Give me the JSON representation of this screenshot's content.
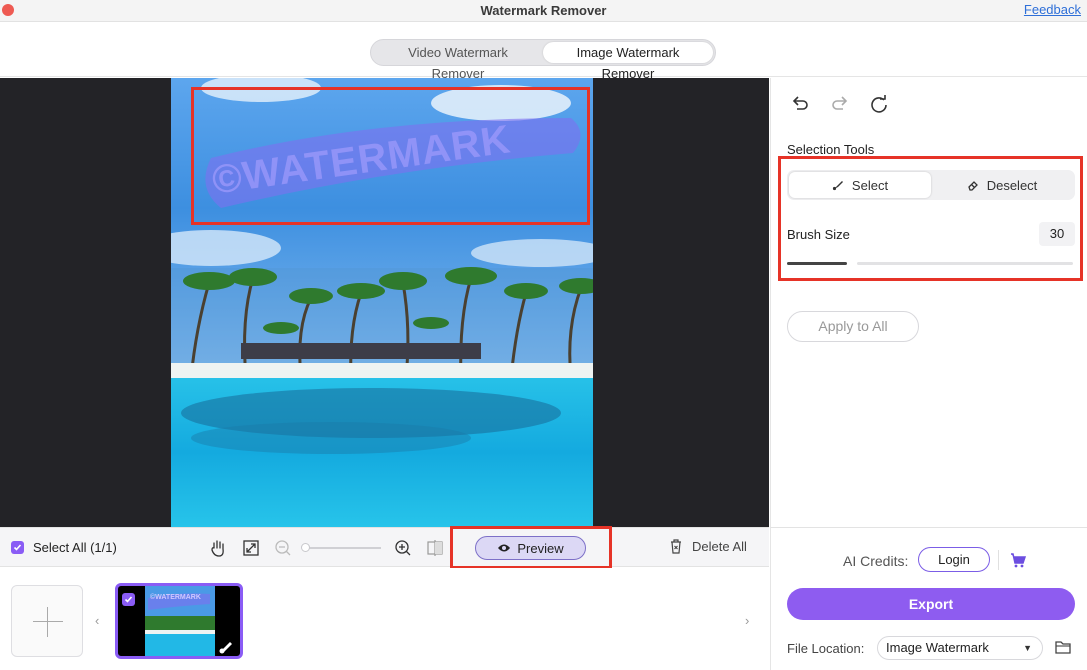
{
  "app": {
    "title": "Watermark Remover",
    "feedback_link": "Feedback"
  },
  "tabs": [
    {
      "label": "Video Watermark Remover",
      "active": false
    },
    {
      "label": "Image Watermark Remover",
      "active": true
    }
  ],
  "canvas": {
    "watermark_text": "©WATERMARK"
  },
  "right_panel": {
    "selection_tools_label": "Selection Tools",
    "select_label": "Select",
    "deselect_label": "Deselect",
    "brush_size_label": "Brush Size",
    "brush_size_value": "30",
    "apply_to_all_label": "Apply to All"
  },
  "toolbar": {
    "select_all_label": "Select All (1/1)",
    "preview_label": "Preview",
    "delete_all_label": "Delete All"
  },
  "thumbnail": {
    "watermark_text": "©WATERMARK"
  },
  "export_panel": {
    "ai_credits_label": "AI Credits:",
    "login_label": "Login",
    "export_label": "Export",
    "file_location_label": "File Location:",
    "file_location_value": "Image Watermark"
  },
  "colors": {
    "accent": "#8e5cf0",
    "highlight": "#e63327",
    "canvas_bg": "#232327"
  },
  "icons": [
    "undo-icon",
    "redo-icon",
    "reset-icon",
    "brush-icon",
    "eraser-icon",
    "hand-icon",
    "fit-icon",
    "zoom-out-icon",
    "zoom-in-icon",
    "compare-icon",
    "eye-icon",
    "trash-icon",
    "cart-icon",
    "folder-icon"
  ]
}
